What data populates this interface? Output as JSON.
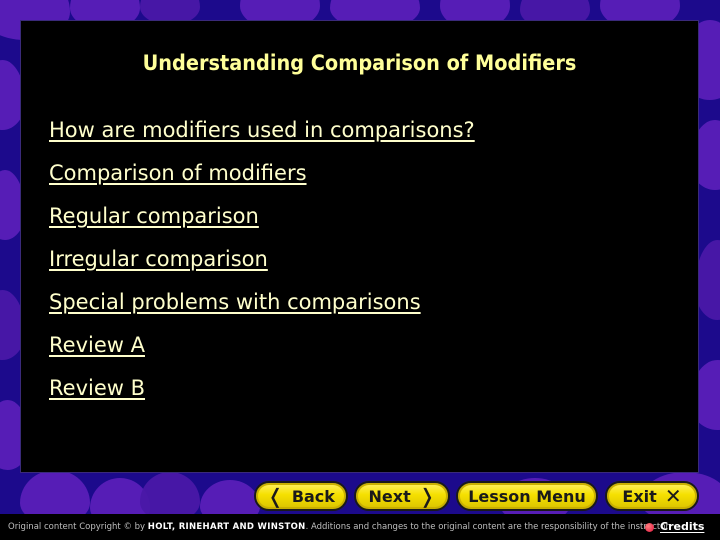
{
  "slide": {
    "title": "Understanding Comparison of Modifiers",
    "links": [
      "How are modifiers used in comparisons?",
      "Comparison of modifiers",
      "Regular comparison",
      "Irregular comparison",
      "Special problems with comparisons",
      "Review A",
      "Review B"
    ]
  },
  "nav": {
    "back_label": "Back",
    "next_label": "Next",
    "lesson_menu_label": "Lesson Menu",
    "exit_label": "Exit",
    "back_icon": "chevron-left-icon",
    "next_icon": "chevron-right-icon",
    "exit_icon": "close-icon"
  },
  "footer": {
    "copyright_prefix": "Original content Copyright © by",
    "publisher": "HOLT, RINEHART AND WINSTON",
    "copyright_suffix": ". Additions and changes to the original content are the responsibility of the instructor.",
    "credits_label": "Credits"
  },
  "colors": {
    "title": "#ffff99",
    "link": "#ffffcc",
    "button": "#f5e000",
    "background": "#5a1fb8",
    "panel": "#000000"
  }
}
